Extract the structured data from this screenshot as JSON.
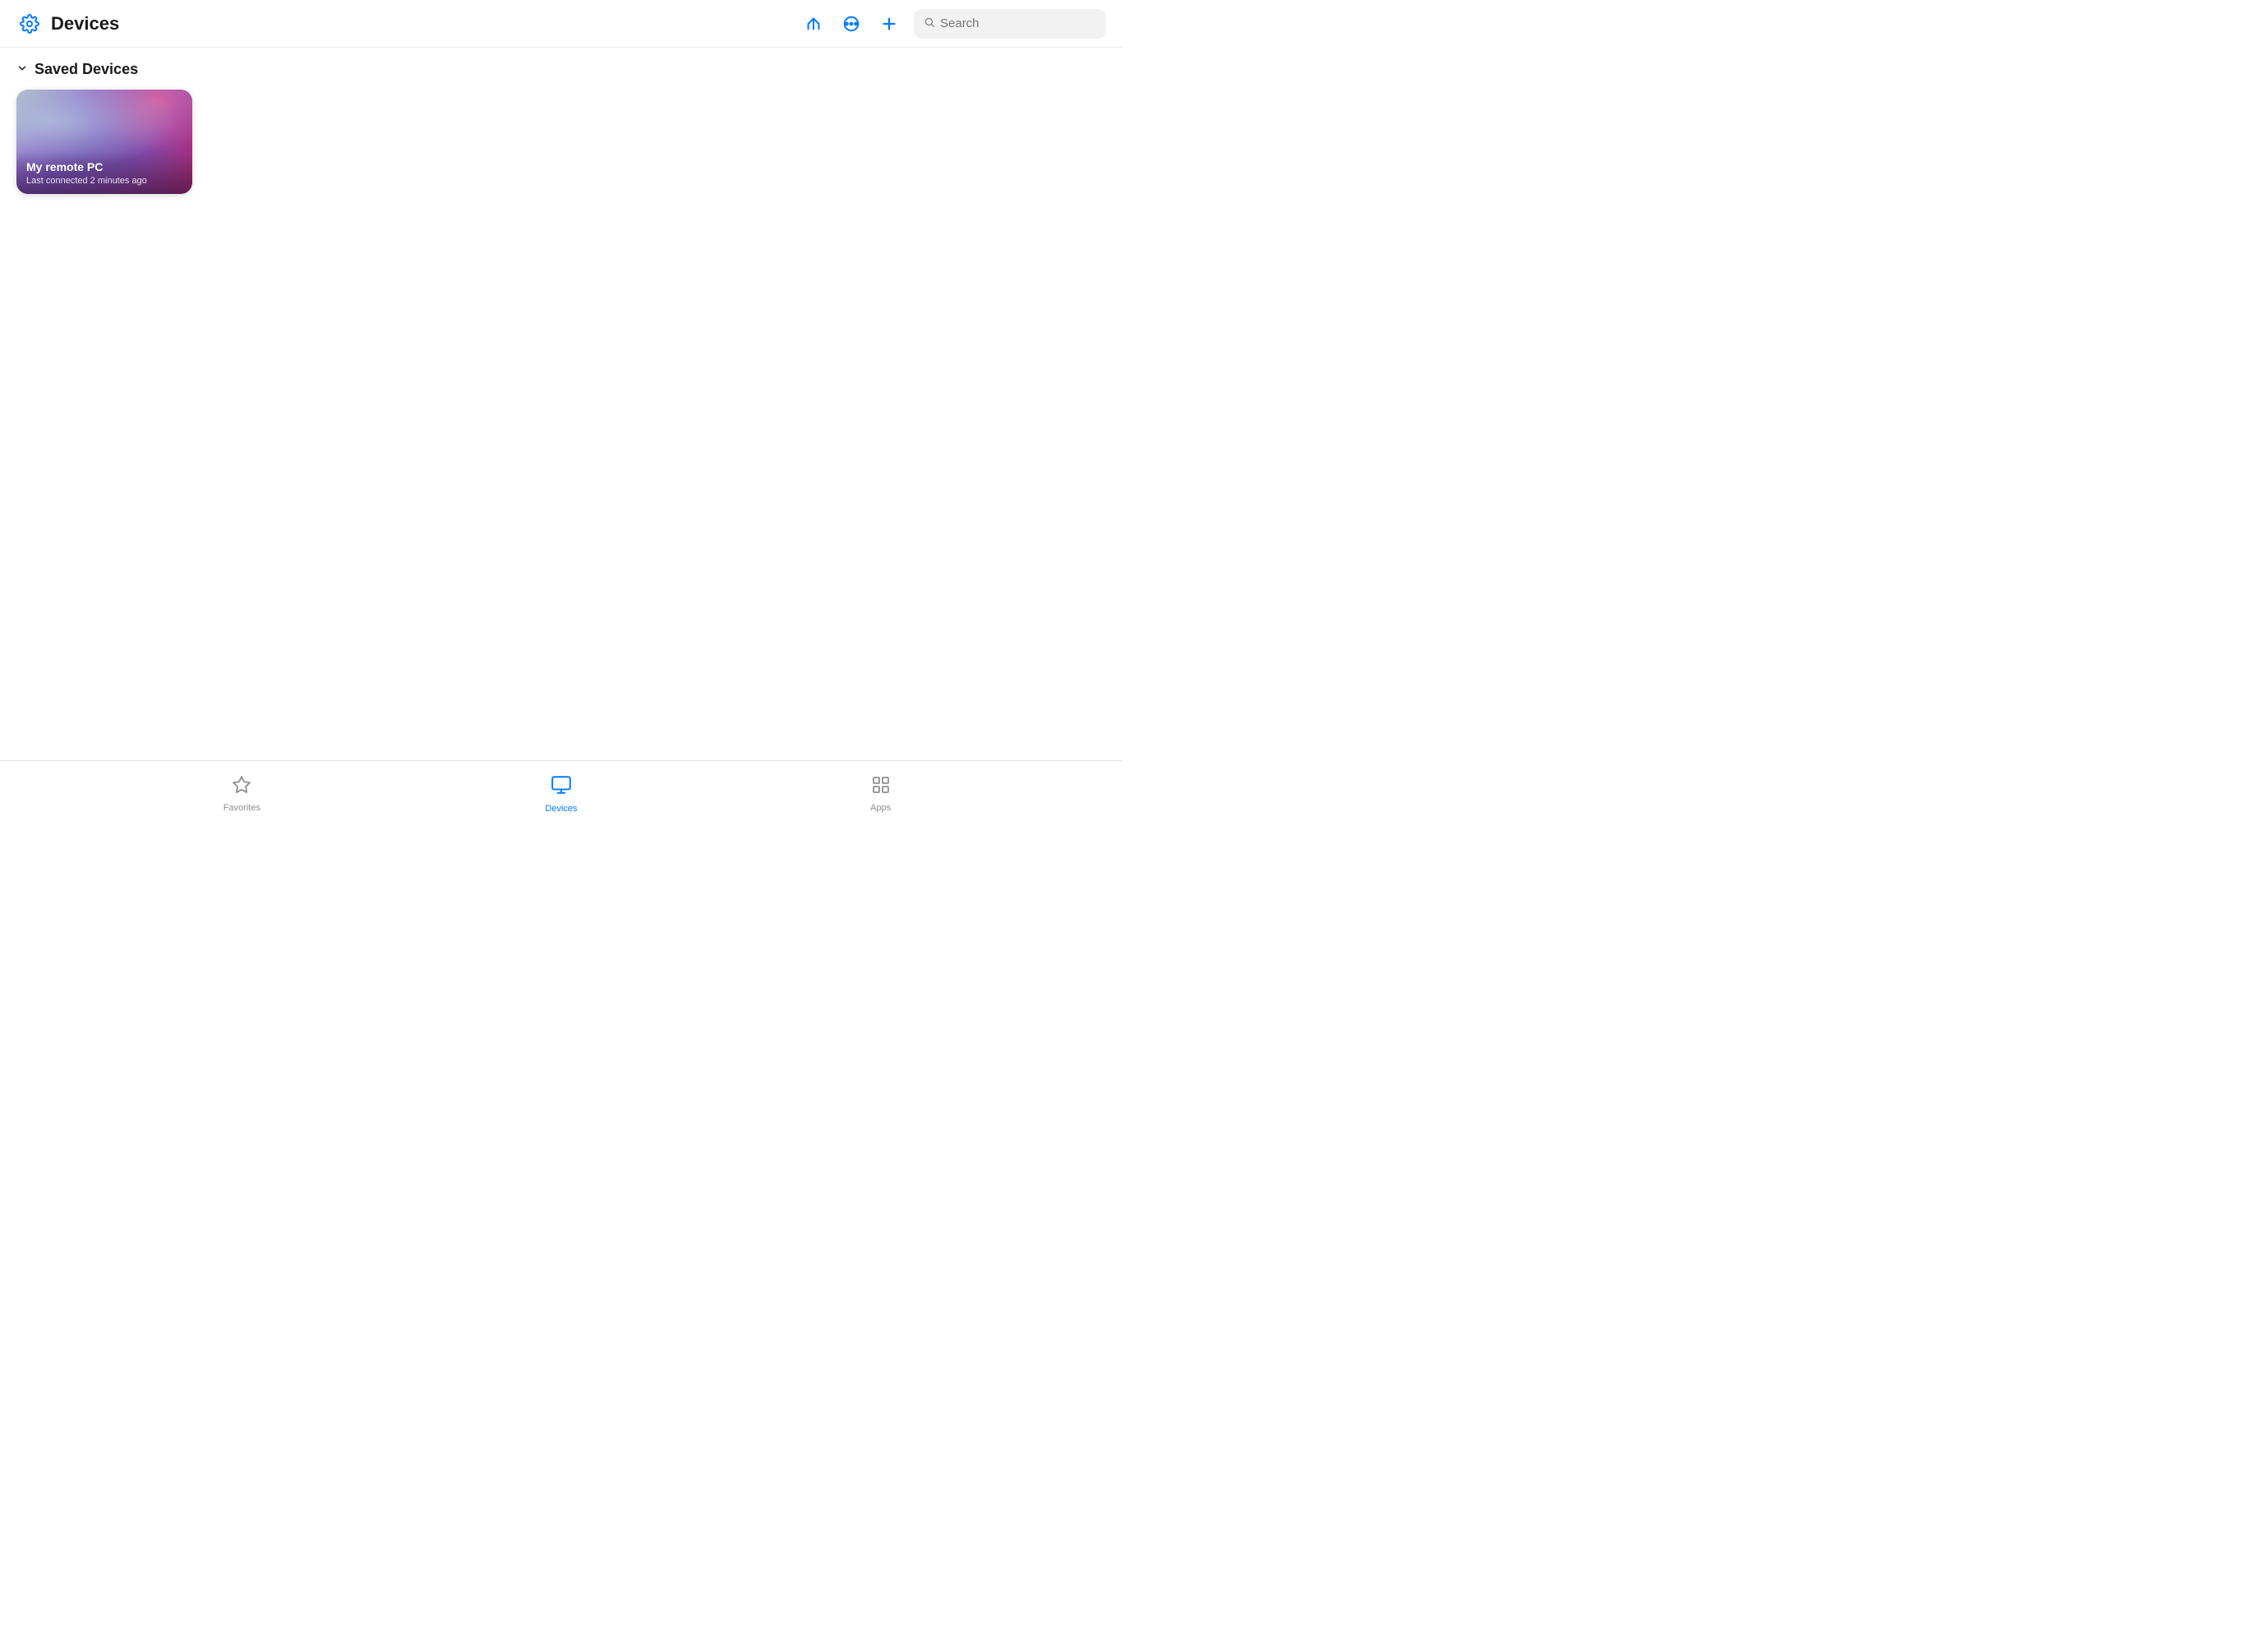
{
  "header": {
    "title": "Devices",
    "gear_icon": "gear-icon",
    "sort_icon": "sort-icon",
    "more_icon": "more-icon",
    "add_icon": "add-icon",
    "search": {
      "placeholder": "Search",
      "value": ""
    }
  },
  "saved_section": {
    "title": "Saved Devices",
    "chevron": "chevron-down-icon",
    "devices": [
      {
        "name": "My remote PC",
        "status": "Last connected 2 minutes ago"
      }
    ]
  },
  "tab_bar": {
    "tabs": [
      {
        "id": "favorites",
        "label": "Favorites",
        "icon": "star-icon",
        "active": false
      },
      {
        "id": "devices",
        "label": "Devices",
        "icon": "monitor-icon",
        "active": true
      },
      {
        "id": "apps",
        "label": "Apps",
        "icon": "apps-icon",
        "active": false
      }
    ]
  }
}
